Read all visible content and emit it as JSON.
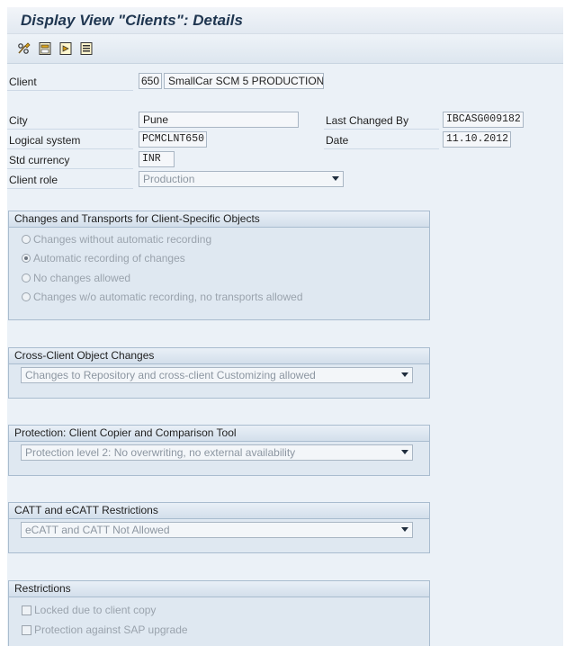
{
  "header": {
    "title": "Display View \"Clients\": Details"
  },
  "toolbar": {
    "items": [
      {
        "icon": "glasses-change-display-icon"
      },
      {
        "icon": "save-entry-icon"
      },
      {
        "icon": "next-entry-icon"
      },
      {
        "icon": "other-entry-icon"
      }
    ]
  },
  "form": {
    "client_label": "Client",
    "client_code": "650",
    "client_name": "SmallCar SCM 5 PRODUCTION",
    "city_label": "City",
    "city_value": "Pune",
    "last_changed_by_label": "Last Changed By",
    "last_changed_by_value": "IBCASG009182",
    "logical_system_label": "Logical system",
    "logical_system_value": "PCMCLNT650",
    "date_label": "Date",
    "date_value": "11.10.2012",
    "std_currency_label": "Std currency",
    "std_currency_value": "INR",
    "client_role_label": "Client role",
    "client_role_value": "Production"
  },
  "changes_group": {
    "title": "Changes and Transports for Client-Specific Objects",
    "options": [
      {
        "label": "Changes without automatic recording",
        "selected": false
      },
      {
        "label": "Automatic recording of changes",
        "selected": true
      },
      {
        "label": "No changes allowed",
        "selected": false
      },
      {
        "label": "Changes w/o automatic recording, no transports allowed",
        "selected": false
      }
    ]
  },
  "cross_client_group": {
    "title": "Cross-Client Object Changes",
    "value": "Changes to Repository and cross-client Customizing allowed"
  },
  "protection_group": {
    "title": "Protection: Client Copier and Comparison Tool",
    "value": "Protection level 2: No overwriting, no external availability"
  },
  "catt_group": {
    "title": "CATT and eCATT Restrictions",
    "value": "eCATT and CATT Not Allowed"
  },
  "restrictions_group": {
    "title": "Restrictions",
    "options": [
      {
        "label": "Locked due to client copy",
        "checked": false
      },
      {
        "label": "Protection against SAP upgrade",
        "checked": false
      }
    ]
  },
  "colors": {
    "title_text": "#1f3650",
    "panel_bg": "#ebf1f7",
    "group_bg": "#dfe8f1",
    "group_border": "#a9bccf",
    "disabled_text": "#9aa3ad"
  }
}
